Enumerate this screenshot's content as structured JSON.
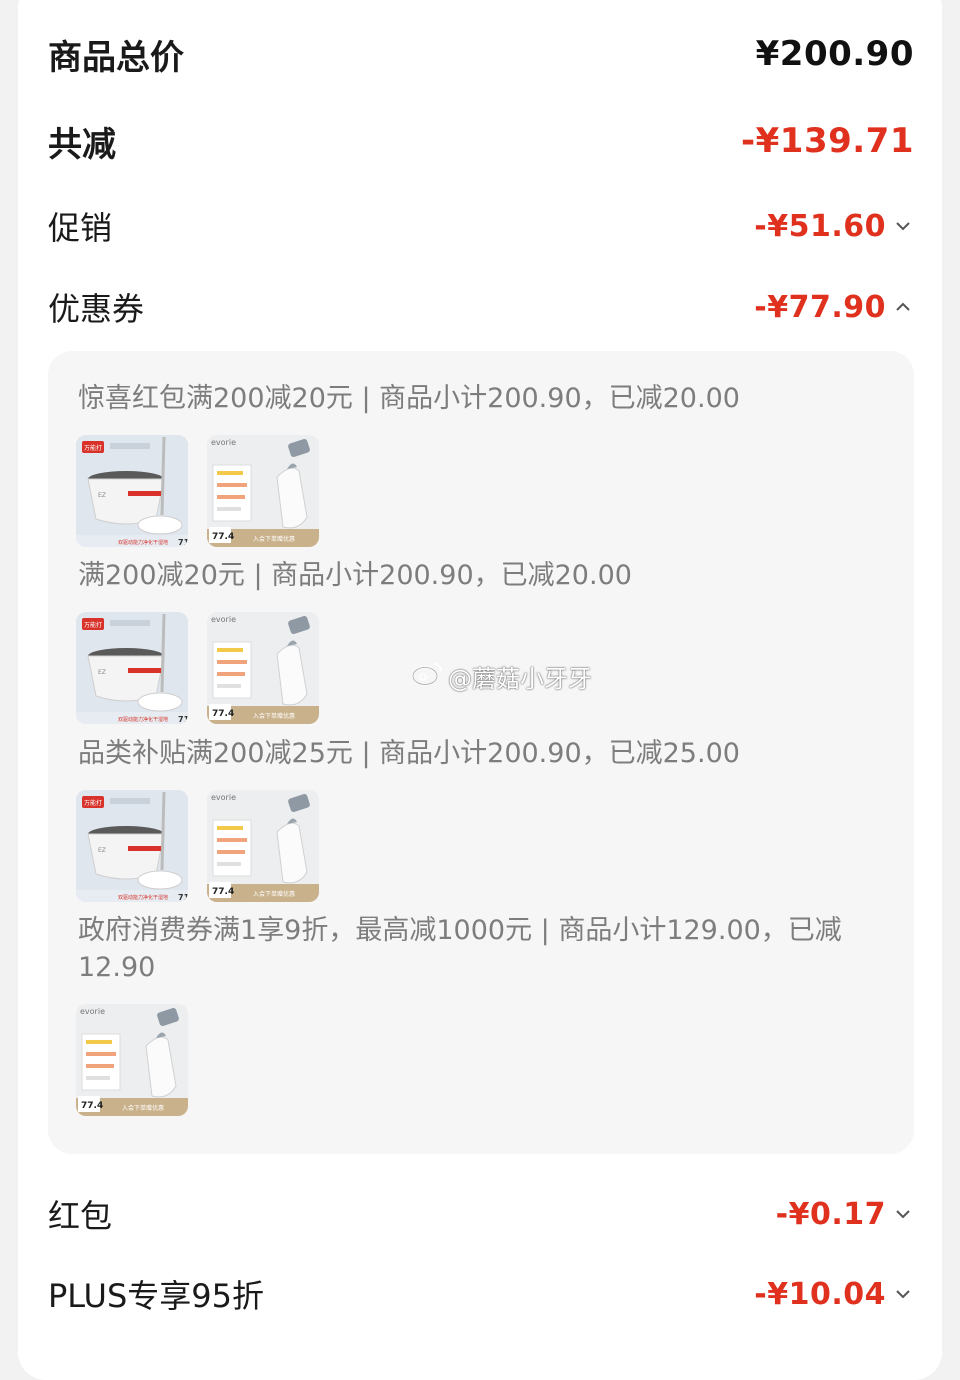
{
  "summary": {
    "total_label": "商品总价",
    "total_value": "¥200.90",
    "reduction_label": "共减",
    "reduction_value": "-¥139.71",
    "promo_label": "促销",
    "promo_value": "-¥51.60",
    "coupon_label": "优惠券",
    "coupon_value": "-¥77.90",
    "redpacket_label": "红包",
    "redpacket_value": "-¥0.17",
    "plus_label": "PLUS专享95折",
    "plus_value": "-¥10.04"
  },
  "coupons": [
    {
      "text": "惊喜红包满200减20元 | 商品小计200.90，已减20.00"
    },
    {
      "text": "满200减20元 | 商品小计200.90，已减20.00"
    },
    {
      "text": "品类补贴满200减25元 | 商品小计200.90，已减25.00"
    },
    {
      "text": "政府消费券满1享9折，最高减1000元 | 商品小计129.00，已减12.90"
    }
  ],
  "products": {
    "mop": {
      "badge": "万能打",
      "tag": "EZ",
      "strip_text": "双驱动能力净化干湿地",
      "price_tag": "71"
    },
    "bottle": {
      "brand": "evorie",
      "price": "77.4",
      "strip_text": "入会下单赠优惠"
    }
  },
  "watermark": {
    "text": "@蘑菇小牙牙"
  },
  "colors": {
    "accent_red": "#e0311f",
    "muted_text": "#7d7d7d",
    "panel_bg": "#f6f6f6"
  },
  "icons": {
    "chevron_down": "chevron-down-icon",
    "chevron_up": "chevron-up-icon",
    "weibo": "weibo-logo-icon"
  }
}
